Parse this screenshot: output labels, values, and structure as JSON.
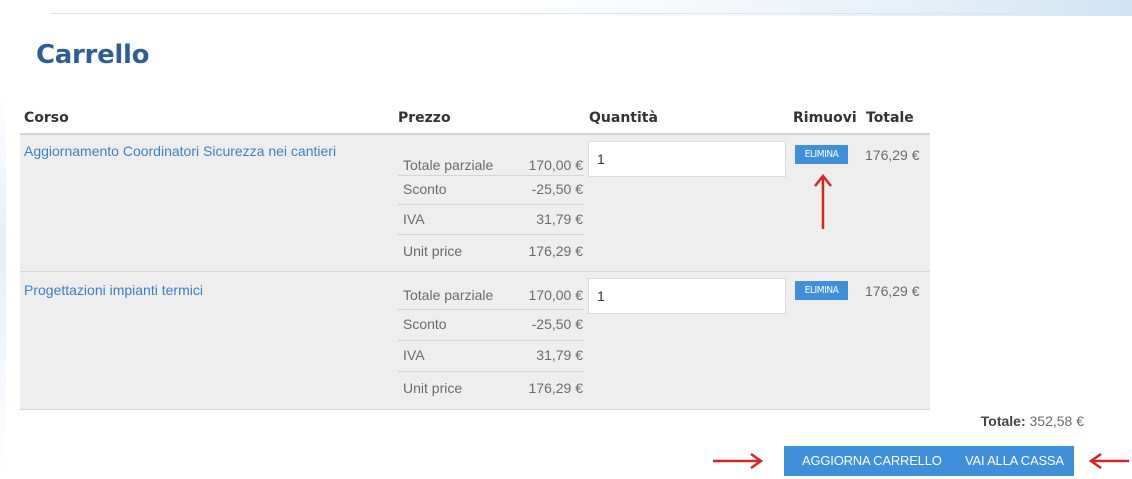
{
  "title": "Carrello",
  "columns": {
    "course": "Corso",
    "price": "Prezzo",
    "quantity": "Quantità",
    "remove": "Rimuovi",
    "total": "Totale"
  },
  "items": [
    {
      "name": "Aggiornamento Coordinatori Sicurezza nei cantieri",
      "prices": [
        {
          "label": "Totale parziale",
          "value": "170,00 €"
        },
        {
          "label": "Sconto",
          "value": "-25,50 €"
        },
        {
          "label": "IVA",
          "value": "31,79 €"
        },
        {
          "label": "Unit price",
          "value": "176,29 €"
        }
      ],
      "quantity": "1",
      "remove_label": "ELIMINA",
      "total": "176,29 €"
    },
    {
      "name": "Progettazioni impianti termici",
      "prices": [
        {
          "label": "Totale parziale",
          "value": "170,00 €"
        },
        {
          "label": "Sconto",
          "value": "-25,50 €"
        },
        {
          "label": "IVA",
          "value": "31,79 €"
        },
        {
          "label": "Unit price",
          "value": "176,29 €"
        }
      ],
      "quantity": "1",
      "remove_label": "ELIMINA",
      "total": "176,29 €"
    }
  ],
  "summary": {
    "total_label": "Totale:",
    "total_value": "352,58 €"
  },
  "actions": {
    "update_cart": "AGGIORNA CARRELLO",
    "checkout": "VAI ALLA CASSA"
  },
  "colors": {
    "accent": "#3f8fdb",
    "title": "#2e5f93",
    "link": "#3d7fc4",
    "annotation_arrow": "#d42424"
  },
  "annotations": [
    "arrow-up-icon",
    "arrow-right-icon",
    "arrow-left-icon"
  ]
}
